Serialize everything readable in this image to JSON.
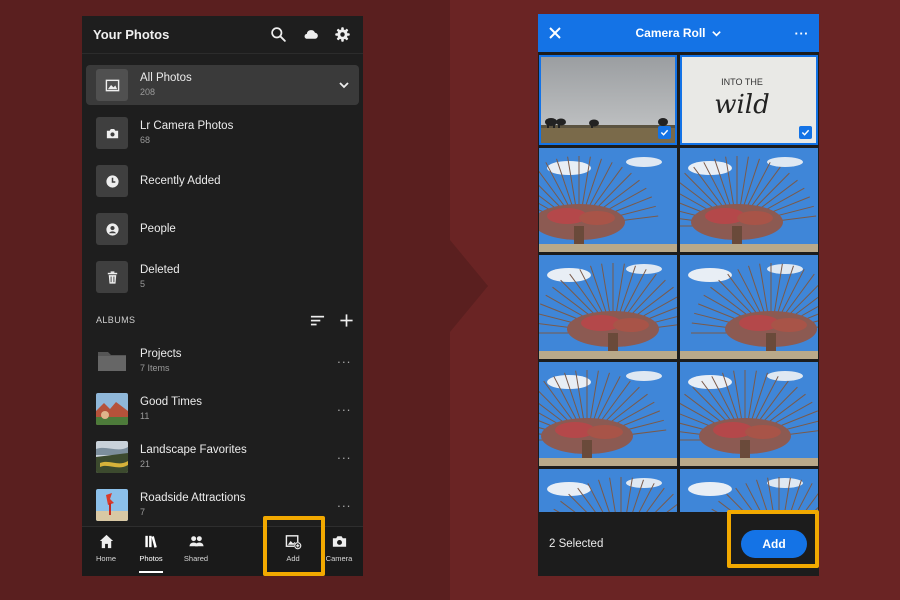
{
  "left_panel": {
    "title": "Your Photos",
    "header_icons": [
      "search-icon",
      "cloud-icon",
      "gear-icon"
    ],
    "sources": [
      {
        "name": "All Photos",
        "count": "208",
        "icon": "image-icon",
        "selected": true
      },
      {
        "name": "Lr Camera Photos",
        "count": "68",
        "icon": "camera-icon"
      },
      {
        "name": "Recently Added",
        "count": "",
        "icon": "clock-icon"
      },
      {
        "name": "People",
        "count": "",
        "icon": "person-icon"
      },
      {
        "name": "Deleted",
        "count": "5",
        "icon": "trash-icon"
      }
    ],
    "albums_label": "ALBUMS",
    "albums": [
      {
        "name": "Projects",
        "count": "7 Items",
        "more": "···"
      },
      {
        "name": "Good Times",
        "count": "11",
        "more": "···"
      },
      {
        "name": "Landscape Favorites",
        "count": "21",
        "more": "···"
      },
      {
        "name": "Roadside Attractions",
        "count": "7",
        "more": "···"
      }
    ],
    "tabs": [
      {
        "label": "Home",
        "icon": "home-icon"
      },
      {
        "label": "Photos",
        "icon": "library-icon",
        "active": true
      },
      {
        "label": "Shared",
        "icon": "people-icon"
      },
      {
        "label": "Add",
        "icon": "add-photo-icon"
      },
      {
        "label": "Camera",
        "icon": "camera-icon"
      }
    ]
  },
  "right_panel": {
    "title": "Camera Roll",
    "more": "···",
    "selected_text": "2 Selected",
    "add_label": "Add",
    "thumbnail_text": {
      "into": "INTO THE",
      "wild": "wild"
    }
  },
  "colors": {
    "accent_blue": "#1473e6",
    "highlight_orange": "#f2a900",
    "background": "#5a1f1f"
  }
}
